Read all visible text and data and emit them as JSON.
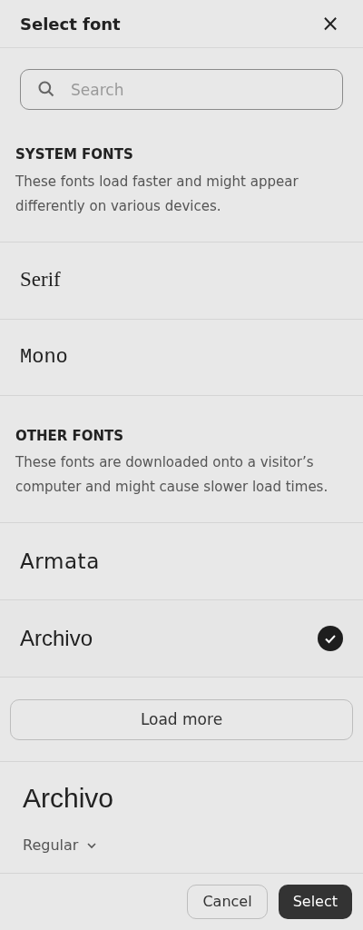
{
  "dialog": {
    "title": "Select font",
    "close": "×"
  },
  "search": {
    "placeholder": "Search"
  },
  "sections": [
    {
      "heading": "SYSTEM FONTS",
      "description": "These fonts load faster and might appear differently on various devices.",
      "fonts": [
        {
          "name": "Serif",
          "kind": "serif",
          "selected": false
        },
        {
          "name": "Mono",
          "kind": "mono",
          "selected": false
        }
      ]
    },
    {
      "heading": "OTHER FONTS",
      "description": "These fonts are downloaded onto a visitor’s computer and might cause slower load times.",
      "fonts": [
        {
          "name": "Armata",
          "kind": "wide",
          "selected": false
        },
        {
          "name": "Archivo",
          "kind": "sans",
          "selected": true
        }
      ]
    }
  ],
  "load_more": "Load more",
  "preview": {
    "font": "Archivo",
    "weight": "Regular"
  },
  "buttons": {
    "cancel": "Cancel",
    "select": "Select"
  }
}
